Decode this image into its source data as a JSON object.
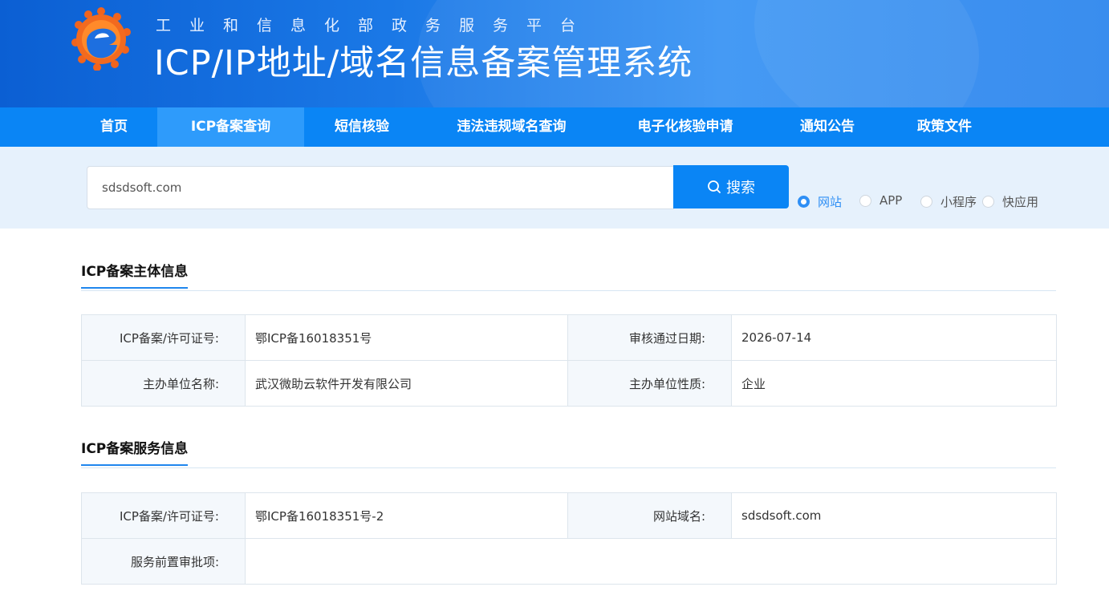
{
  "header": {
    "subtitle": "工业和信息化部政务服务平台",
    "title": "ICP/IP地址/域名信息备案管理系统"
  },
  "nav": {
    "items": [
      "首页",
      "ICP备案查询",
      "短信核验",
      "违法违规域名查询",
      "电子化核验申请",
      "通知公告",
      "政策文件"
    ],
    "active": "ICP备案查询"
  },
  "search": {
    "value": "sdsdsoft.com",
    "button_label": "搜索",
    "types": [
      "网站",
      "APP",
      "小程序",
      "快应用"
    ],
    "selected_type": "网站"
  },
  "subject": {
    "title": "ICP备案主体信息",
    "rows": [
      [
        {
          "label": "ICP备案/许可证号:",
          "value": "鄂ICP备16018351号"
        },
        {
          "label": "审核通过日期:",
          "value": "2026-07-14"
        }
      ],
      [
        {
          "label": "主办单位名称:",
          "value": "武汉微助云软件开发有限公司"
        },
        {
          "label": "主办单位性质:",
          "value": "企业"
        }
      ]
    ]
  },
  "service": {
    "title": "ICP备案服务信息",
    "rows": [
      [
        {
          "label": "ICP备案/许可证号:",
          "value": "鄂ICP备16018351号-2"
        },
        {
          "label": "网站域名:",
          "value": "sdsdsoft.com"
        }
      ],
      [
        {
          "label": "服务前置审批项:",
          "value": ""
        }
      ]
    ]
  },
  "colors": {
    "nav_bg": "#0a85f5",
    "nav_active": "#2e9bfb",
    "accent": "#1f86ee",
    "search_band": "#e6f1fc"
  }
}
